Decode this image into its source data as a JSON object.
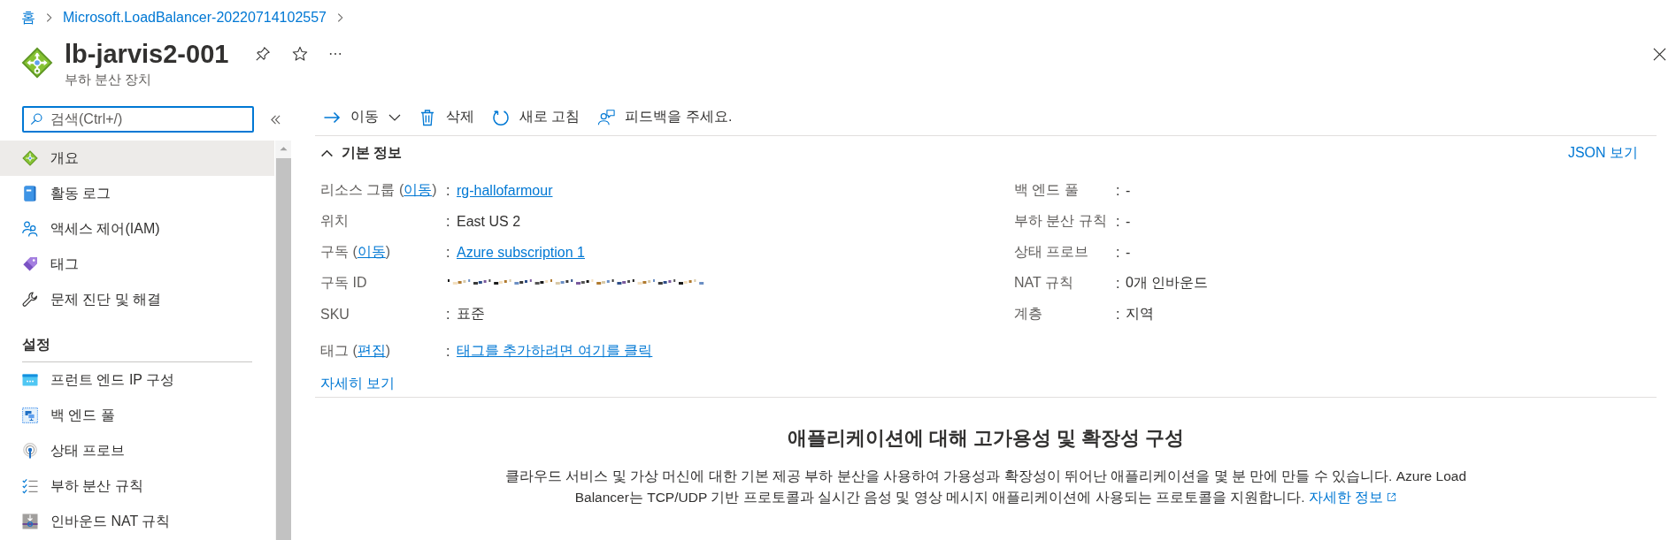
{
  "breadcrumb": [
    {
      "label": "홈"
    },
    {
      "label": "Microsoft.LoadBalancer-20220714102557"
    }
  ],
  "header": {
    "title": "lb-jarvis2-001",
    "subtitle": "부하 분산 장치"
  },
  "sidebar": {
    "search": {
      "placeholder": "검색(Ctrl+/)",
      "focused": true
    },
    "sections": [
      {
        "items": [
          {
            "label": "개요",
            "selected": true
          },
          {
            "label": "활동 로그",
            "selected": false
          },
          {
            "label": "액세스 제어(IAM)",
            "selected": false
          },
          {
            "label": "태그",
            "selected": false
          },
          {
            "label": "문제 진단 및 해결",
            "selected": false
          }
        ]
      },
      {
        "title": "설정",
        "items": [
          {
            "label": "프런트 엔드 IP 구성",
            "selected": false
          },
          {
            "label": "백 엔드 풀",
            "selected": false
          },
          {
            "label": "상태 프로브",
            "selected": false
          },
          {
            "label": "부하 분산 규칙",
            "selected": false
          },
          {
            "label": "인바운드 NAT 규칙",
            "selected": false
          }
        ]
      }
    ]
  },
  "toolbar": [
    {
      "label": "이동",
      "dropdown": true
    },
    {
      "label": "삭제",
      "dropdown": false
    },
    {
      "label": "새로 고침",
      "dropdown": false
    },
    {
      "label": "피드백을 주세요.",
      "dropdown": false
    }
  ],
  "essentials": {
    "title": "기본 정보",
    "expanded": true,
    "json_link": "JSON 보기",
    "left": [
      {
        "kind": "link",
        "label": "리소스 그룹 (",
        "label_link": "이동",
        "label_end": ")",
        "separator": ":",
        "value": "rg-hallofarmour"
      },
      {
        "kind": "text",
        "label": "위치",
        "separator": ":",
        "value": "East US 2"
      },
      {
        "kind": "link",
        "label": "구독 (",
        "label_link": "이동",
        "label_end": ")",
        "separator": ":",
        "value": "Azure subscription 1"
      },
      {
        "kind": "redacted",
        "label": "구독 ID"
      },
      {
        "kind": "text",
        "label": "SKU",
        "separator": ":",
        "value": "표준"
      }
    ],
    "right": [
      {
        "kind": "text",
        "label": "백 엔드 풀",
        "separator": ":",
        "value": "-"
      },
      {
        "kind": "text",
        "label": "부하 분산 규칙",
        "separator": ":",
        "value": "-"
      },
      {
        "kind": "text",
        "label": "상태 프로브",
        "separator": ":",
        "value": "-"
      },
      {
        "kind": "text",
        "label": "NAT 규칙",
        "separator": ":",
        "value": "0개 인바운드"
      },
      {
        "kind": "text",
        "label": "계층",
        "separator": ":",
        "value": "지역"
      }
    ],
    "tags": {
      "kind": "link",
      "label": "태그 (",
      "label_link": "편집",
      "label_end": ")",
      "separator": ":",
      "value": "태그를 추가하려면 여기를 클릭"
    },
    "more_link": "자세히 보기"
  },
  "promo": {
    "title": "애플리케이션에 대해 고가용성 및 확장성 구성",
    "body": "클라우드 서비스 및 가상 머신에 대한 기본 제공 부하 분산을 사용하여 가용성과 확장성이 뛰어난 애플리케이션을 몇 분 만에 만들 수 있습니다. Azure Load Balancer는 TCP/UDP 기반 프로토콜과 실시간 음성 및 영상 메시지 애플리케이션에 사용되는 프로토콜을 지원합니다.",
    "link": "자세한 정보"
  }
}
